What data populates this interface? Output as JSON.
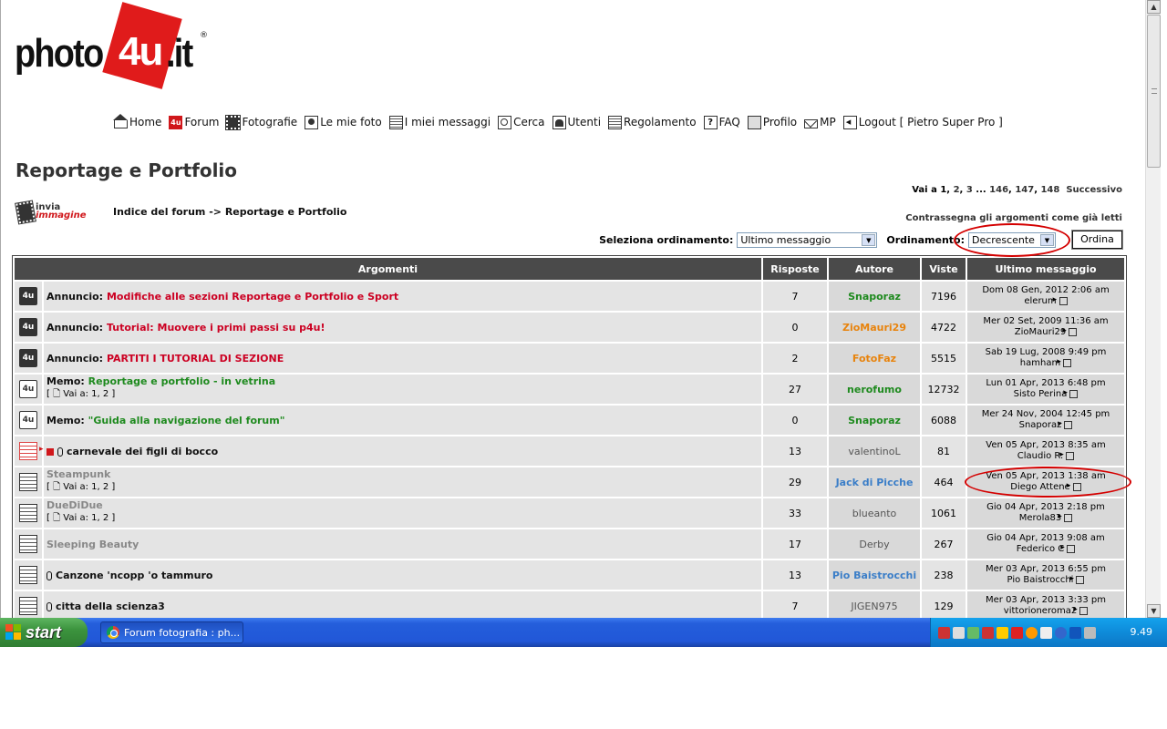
{
  "logo": {
    "text_left": "photo",
    "text_mid": "4u",
    "text_right": ".it",
    "reg": "®"
  },
  "nav": [
    {
      "label": "Home",
      "icon": "home-icon"
    },
    {
      "label": "Forum",
      "icon": "forum-icon"
    },
    {
      "label": "Fotografie",
      "icon": "film-icon"
    },
    {
      "label": "Le mie foto",
      "icon": "photo-icon"
    },
    {
      "label": "I miei messaggi",
      "icon": "messages-icon"
    },
    {
      "label": "Cerca",
      "icon": "search-icon"
    },
    {
      "label": "Utenti",
      "icon": "users-icon"
    },
    {
      "label": "Regolamento",
      "icon": "rules-icon"
    },
    {
      "label": "FAQ",
      "icon": "faq-icon"
    },
    {
      "label": "Profilo",
      "icon": "profile-icon"
    },
    {
      "label": "MP",
      "icon": "mail-icon"
    },
    {
      "label": "Logout [ Pietro Super Pro ]",
      "icon": "logout-icon"
    }
  ],
  "forum_title": "Reportage e Portfolio",
  "pagination": {
    "prefix": "Vai a",
    "pages": [
      "1",
      "2",
      "3",
      "...",
      "146",
      "147",
      "148"
    ],
    "next": "Successivo"
  },
  "mark_read": "Contrassegna gli argomenti come già letti",
  "upload": {
    "line1": "invia",
    "line2": "immagine"
  },
  "breadcrumb": "Indice del forum -> Reportage e Portfolio",
  "sort": {
    "select_label": "Seleziona ordinamento:",
    "select_value": "Ultimo messaggio",
    "order_label": "Ordinamento:",
    "order_value": "Decrescente",
    "button": "Ordina"
  },
  "table": {
    "headers": [
      "Argomenti",
      "Risposte",
      "Autore",
      "Viste",
      "Ultimo messaggio"
    ],
    "rows": [
      {
        "icon": "announcement",
        "prefix": "Annuncio:",
        "title": "Modifiche alle sezioni Reportage e Portfolio e Sport",
        "title_color": "#cc0022",
        "pages": "",
        "replies": "7",
        "author": "Snaporaz",
        "author_color": "#1e8a1e",
        "views": "7196",
        "last_date": "Dom 08 Gen, 2012 2:06 am",
        "last_user": "elerum"
      },
      {
        "icon": "announcement",
        "prefix": "Annuncio:",
        "title": "Tutorial: Muovere i primi passi su p4u!",
        "title_color": "#cc0022",
        "pages": "",
        "replies": "0",
        "author": "ZioMauri29",
        "author_color": "#e8830c",
        "views": "4722",
        "last_date": "Mer 02 Set, 2009 11:36 am",
        "last_user": "ZioMauri29"
      },
      {
        "icon": "announcement",
        "prefix": "Annuncio:",
        "title": "PARTITI I TUTORIAL DI SEZIONE",
        "title_color": "#cc0022",
        "pages": "",
        "replies": "2",
        "author": "FotoFaz",
        "author_color": "#e8830c",
        "views": "5515",
        "last_date": "Sab 19 Lug, 2008 9:49 pm",
        "last_user": "hamham"
      },
      {
        "icon": "memo",
        "prefix": "Memo:",
        "title": "Reportage e portfolio - in vetrina",
        "title_color": "#1e8a1e",
        "pages": "[ 🗋 Vai a: 1, 2 ]",
        "replies": "27",
        "author": "nerofumo",
        "author_color": "#1e8a1e",
        "views": "12732",
        "last_date": "Lun 01 Apr, 2013 6:48 pm",
        "last_user": "Sisto Perina"
      },
      {
        "icon": "memo",
        "prefix": "Memo:",
        "title": "\"Guida alla navigazione del forum\"",
        "title_color": "#1e8a1e",
        "pages": "",
        "replies": "0",
        "author": "Snaporaz",
        "author_color": "#1e8a1e",
        "views": "6088",
        "last_date": "Mer 24 Nov, 2004 12:45 pm",
        "last_user": "Snaporaz"
      },
      {
        "icon": "hot",
        "prefix": "",
        "title": "carnevale dei figli di bocco",
        "title_color": "#111111",
        "attach": true,
        "new": true,
        "pages": "",
        "replies": "13",
        "author": "valentinoL",
        "author_color": "#555555",
        "views": "81",
        "last_date": "Ven 05 Apr, 2013 8:35 am",
        "last_user": "Claudio R."
      },
      {
        "icon": "normal",
        "prefix": "",
        "title": "Steampunk",
        "title_color": "#888888",
        "pages": "[ 🗋 Vai a: 1, 2 ]",
        "replies": "29",
        "author": "Jack di Picche",
        "author_color": "#3b7ec8",
        "views": "464",
        "last_date": "Ven 05 Apr, 2013 1:38 am",
        "last_user": "Diego Attene"
      },
      {
        "icon": "normal",
        "prefix": "",
        "title": "DueDiDue",
        "title_color": "#888888",
        "pages": "[ 🗋 Vai a: 1, 2 ]",
        "replies": "33",
        "author": "blueanto",
        "author_color": "#555555",
        "views": "1061",
        "last_date": "Gio 04 Apr, 2013 2:18 pm",
        "last_user": "Merola83"
      },
      {
        "icon": "normal",
        "prefix": "",
        "title": "Sleeping Beauty",
        "title_color": "#888888",
        "pages": "",
        "replies": "17",
        "author": "Derby",
        "author_color": "#555555",
        "views": "267",
        "last_date": "Gio 04 Apr, 2013 9:08 am",
        "last_user": "Federico C"
      },
      {
        "icon": "normal",
        "prefix": "",
        "title": "Canzone 'ncopp 'o tammuro",
        "title_color": "#111111",
        "attach": true,
        "pages": "",
        "replies": "13",
        "author": "Pio Baistrocchi",
        "author_color": "#3b7ec8",
        "views": "238",
        "last_date": "Mer 03 Apr, 2013 6:55 pm",
        "last_user": "Pio Baistrocchi"
      },
      {
        "icon": "normal",
        "prefix": "",
        "title": "citta della scienza3",
        "title_color": "#111111",
        "attach": true,
        "pages": "",
        "replies": "7",
        "author": "JIGEN975",
        "author_color": "#555555",
        "views": "129",
        "last_date": "Mer 03 Apr, 2013 3:33 pm",
        "last_user": "vittorioneroma2"
      }
    ]
  },
  "taskbar": {
    "start": "start",
    "window_title": "Forum fotografia : ph...",
    "clock": "9.49"
  }
}
